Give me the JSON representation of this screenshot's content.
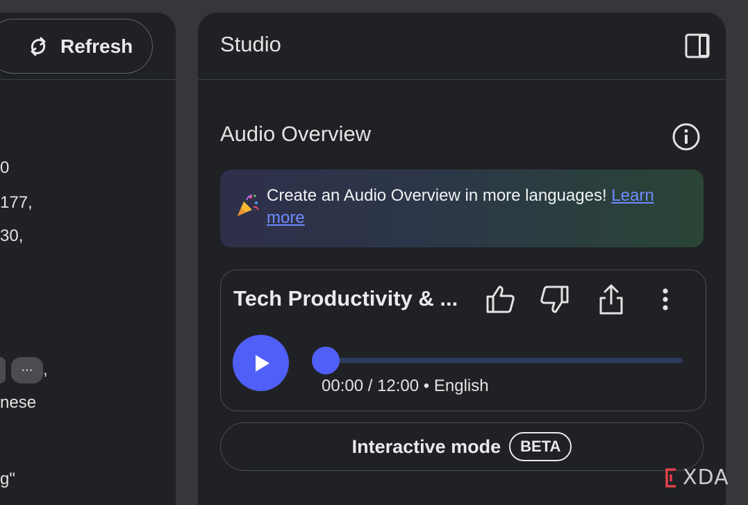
{
  "left_panel": {
    "refresh_label": "Refresh",
    "text_lines": [
      "0",
      "177,",
      "30,",
      "nese",
      "g\""
    ],
    "chip_label": "..."
  },
  "studio": {
    "title": "Studio",
    "audio_overview": {
      "title": "Audio Overview",
      "banner": {
        "text": "Create an Audio Overview in more languages!",
        "link": "Learn more"
      },
      "card": {
        "title": "Tech Productivity & ...",
        "time": "00:00 / 12:00",
        "separator": "•",
        "language": "English",
        "progress": 0
      },
      "interactive_mode": {
        "label": "Interactive mode",
        "badge": "BETA"
      }
    }
  },
  "watermark": {
    "text": "XDA"
  },
  "colors": {
    "accent": "#4f5ff7",
    "panel": "#202124",
    "background": "#36373a",
    "link": "#6e8bff"
  }
}
